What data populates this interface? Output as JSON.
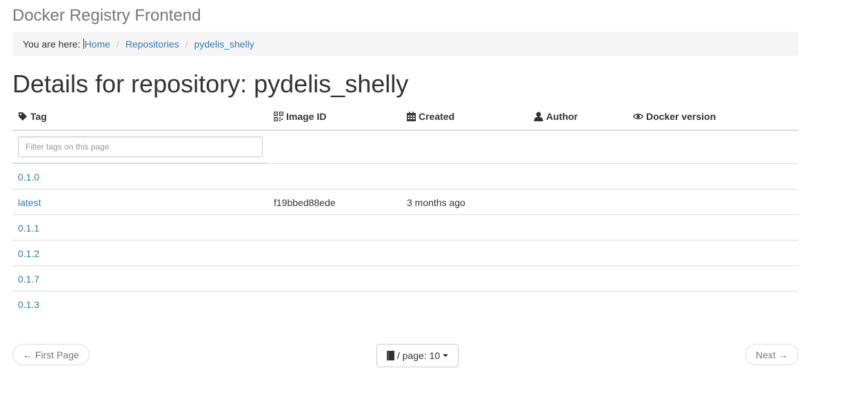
{
  "app": {
    "title": "Docker Registry Frontend"
  },
  "breadcrumb": {
    "prefix": "You are here:",
    "items": [
      "Home",
      "Repositories",
      "pydelis_shelly"
    ],
    "separator": "/"
  },
  "page": {
    "title": "Details for repository: pydelis_shelly"
  },
  "table": {
    "headers": {
      "tag": "Tag",
      "image_id": "Image ID",
      "created": "Created",
      "author": "Author",
      "docker_version": "Docker version"
    },
    "header_icons": {
      "tag": "tag-icon",
      "image_id": "qrcode-icon",
      "created": "calendar-icon",
      "author": "user-icon",
      "docker_version": "eye-icon"
    },
    "filter_placeholder": "Filter tags on this page",
    "rows": [
      {
        "tag": "0.1.0",
        "image_id": "",
        "created": "",
        "author": "",
        "docker_version": ""
      },
      {
        "tag": "latest",
        "image_id": "f19bbed88ede",
        "created": "3 months ago",
        "author": "",
        "docker_version": ""
      },
      {
        "tag": "0.1.1",
        "image_id": "",
        "created": "",
        "author": "",
        "docker_version": ""
      },
      {
        "tag": "0.1.2",
        "image_id": "",
        "created": "",
        "author": "",
        "docker_version": ""
      },
      {
        "tag": "0.1.7",
        "image_id": "",
        "created": "",
        "author": "",
        "docker_version": ""
      },
      {
        "tag": "0.1.3",
        "image_id": "",
        "created": "",
        "author": "",
        "docker_version": ""
      }
    ]
  },
  "pagination": {
    "first_label": "← First Page",
    "next_label": "Next →",
    "per_page_label": "/ page: 10",
    "per_page_icon": "book-icon"
  },
  "colors": {
    "link": "#337ab7",
    "muted": "#777777",
    "border": "#dddddd",
    "breadcrumb_bg": "#f5f5f5"
  }
}
